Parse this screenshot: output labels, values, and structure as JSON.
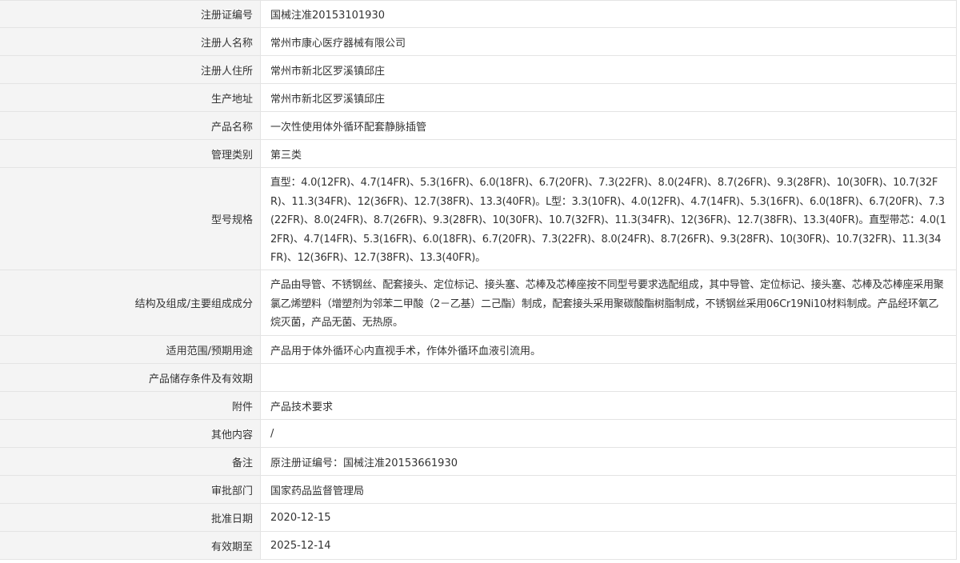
{
  "rows": [
    {
      "label": "注册证编号",
      "value": "国械注准20153101930"
    },
    {
      "label": "注册人名称",
      "value": "常州市康心医疗器械有限公司"
    },
    {
      "label": "注册人住所",
      "value": "常州市新北区罗溪镇邱庄"
    },
    {
      "label": "生产地址",
      "value": "常州市新北区罗溪镇邱庄"
    },
    {
      "label": "产品名称",
      "value": "一次性使用体外循环配套静脉插管"
    },
    {
      "label": "管理类别",
      "value": "第三类"
    },
    {
      "label": "型号规格",
      "value": "直型：4.0(12FR)、4.7(14FR)、5.3(16FR)、6.0(18FR)、6.7(20FR)、7.3(22FR)、8.0(24FR)、8.7(26FR)、9.3(28FR)、10(30FR)、10.7(32FR)、11.3(34FR)、12(36FR)、12.7(38FR)、13.3(40FR)。L型：3.3(10FR)、4.0(12FR)、4.7(14FR)、5.3(16FR)、6.0(18FR)、6.7(20FR)、7.3(22FR)、8.0(24FR)、8.7(26FR)、9.3(28FR)、10(30FR)、10.7(32FR)、11.3(34FR)、12(36FR)、12.7(38FR)、13.3(40FR)。直型带芯：4.0(12FR)、4.7(14FR)、5.3(16FR)、6.0(18FR)、6.7(20FR)、7.3(22FR)、8.0(24FR)、8.7(26FR)、9.3(28FR)、10(30FR)、10.7(32FR)、11.3(34FR)、12(36FR)、12.7(38FR)、13.3(40FR)。"
    },
    {
      "label": "结构及组成/主要组成成分",
      "value": "产品由导管、不锈钢丝、配套接头、定位标记、接头塞、芯棒及芯棒座按不同型号要求选配组成，其中导管、定位标记、接头塞、芯棒及芯棒座采用聚氯乙烯塑料（增塑剂为邻苯二甲酸（2－乙基）二己酯）制成，配套接头采用聚碳酸酯树脂制成，不锈钢丝采用06Cr19Ni10材料制成。产品经环氧乙烷灭菌，产品无菌、无热原。"
    },
    {
      "label": "适用范围/预期用途",
      "value": "产品用于体外循环心内直视手术，作体外循环血液引流用。"
    },
    {
      "label": "产品储存条件及有效期",
      "value": ""
    },
    {
      "label": "附件",
      "value": "产品技术要求"
    },
    {
      "label": "其他内容",
      "value": "/"
    },
    {
      "label": "备注",
      "value": "原注册证编号：国械注准20153661930"
    },
    {
      "label": "审批部门",
      "value": "国家药品监督管理局"
    },
    {
      "label": "批准日期",
      "value": "2020-12-15"
    },
    {
      "label": "有效期至",
      "value": "2025-12-14"
    }
  ]
}
